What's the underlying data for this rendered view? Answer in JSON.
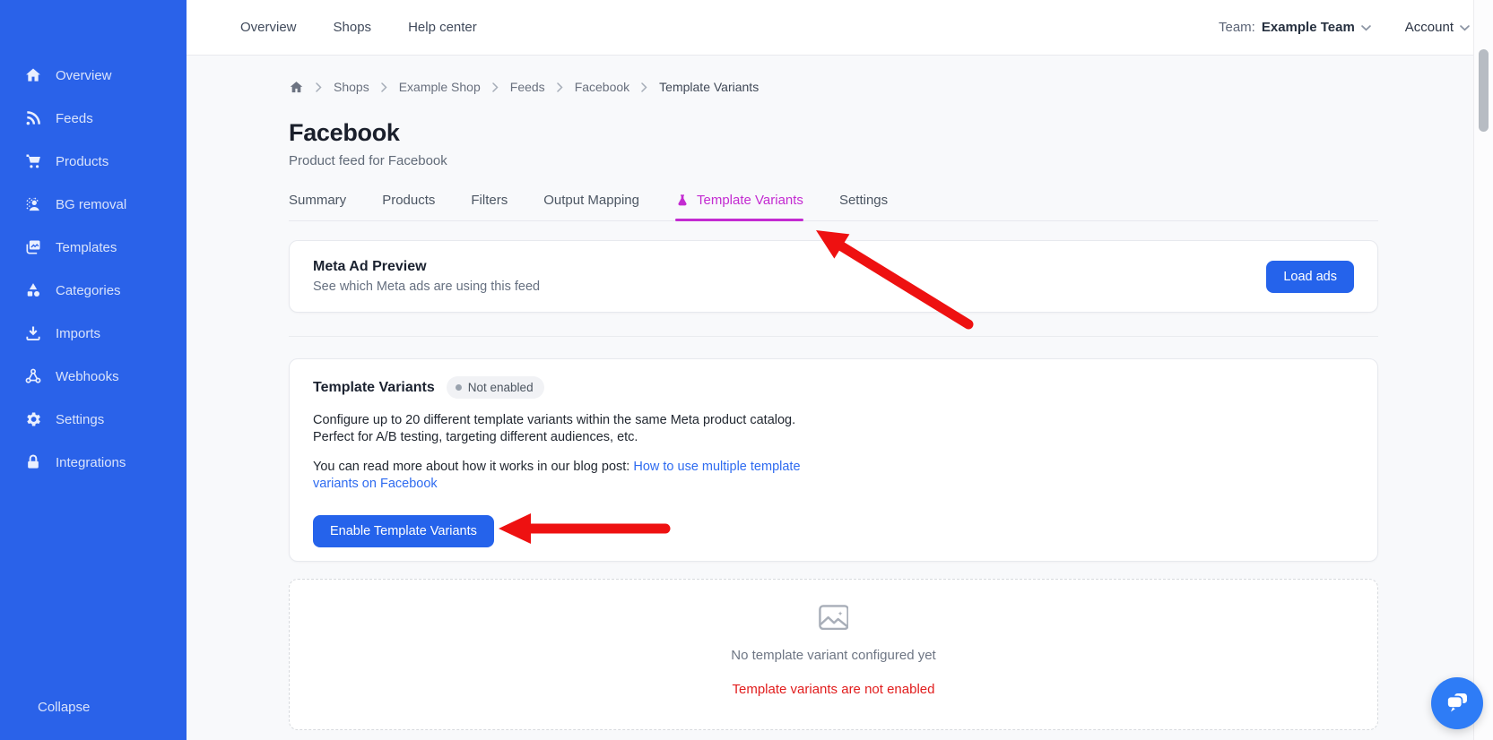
{
  "colors": {
    "sidebar_blue": "#2a62e9",
    "button_blue": "#2563eb",
    "active_tab_magenta": "#c32bd1",
    "link_blue": "#2e6bf0",
    "warning_red": "#e11d1d",
    "arrow_red": "#ee1111",
    "chat_blue": "#2e7cf6"
  },
  "sidebar": {
    "items": [
      {
        "label": "Overview",
        "icon": "home-icon"
      },
      {
        "label": "Feeds",
        "icon": "rss-icon"
      },
      {
        "label": "Products",
        "icon": "cart-icon"
      },
      {
        "label": "BG removal",
        "icon": "person-halftone-icon"
      },
      {
        "label": "Templates",
        "icon": "image-stack-icon"
      },
      {
        "label": "Categories",
        "icon": "shapes-icon"
      },
      {
        "label": "Imports",
        "icon": "download-icon"
      },
      {
        "label": "Webhooks",
        "icon": "webhook-icon"
      },
      {
        "label": "Settings",
        "icon": "gear-icon"
      },
      {
        "label": "Integrations",
        "icon": "lock-icon"
      }
    ],
    "collapse_label": "Collapse"
  },
  "topnav": {
    "links": [
      {
        "label": "Overview"
      },
      {
        "label": "Shops"
      },
      {
        "label": "Help center"
      }
    ],
    "team_prefix": "Team:",
    "team_name": "Example Team",
    "account_label": "Account"
  },
  "breadcrumb": {
    "items": [
      {
        "label": "Shops"
      },
      {
        "label": "Example Shop"
      },
      {
        "label": "Feeds"
      },
      {
        "label": "Facebook"
      },
      {
        "label": "Template Variants"
      }
    ]
  },
  "page": {
    "title": "Facebook",
    "subtitle": "Product feed for Facebook"
  },
  "tabs": [
    {
      "label": "Summary"
    },
    {
      "label": "Products"
    },
    {
      "label": "Filters"
    },
    {
      "label": "Output Mapping"
    },
    {
      "label": "Template Variants",
      "active": true,
      "icon": "flask-icon"
    },
    {
      "label": "Settings"
    }
  ],
  "meta_ad_preview": {
    "title": "Meta Ad Preview",
    "subtitle": "See which Meta ads are using this feed",
    "load_ads_button": "Load ads"
  },
  "template_variants": {
    "title": "Template Variants",
    "status_badge": "Not enabled",
    "description_lines": [
      "Configure up to 20 different template variants within the same Meta product catalog.",
      "Perfect for A/B testing, targeting different audiences, etc."
    ],
    "read_more_prefix": "You can read more about how it works in our blog post:",
    "read_more_link_line1": "How to use multiple template",
    "read_more_link_line2": "variants on Facebook",
    "enable_button": "Enable Template Variants"
  },
  "empty_state": {
    "message": "No template variant configured yet",
    "warning": "Template variants are not enabled"
  }
}
